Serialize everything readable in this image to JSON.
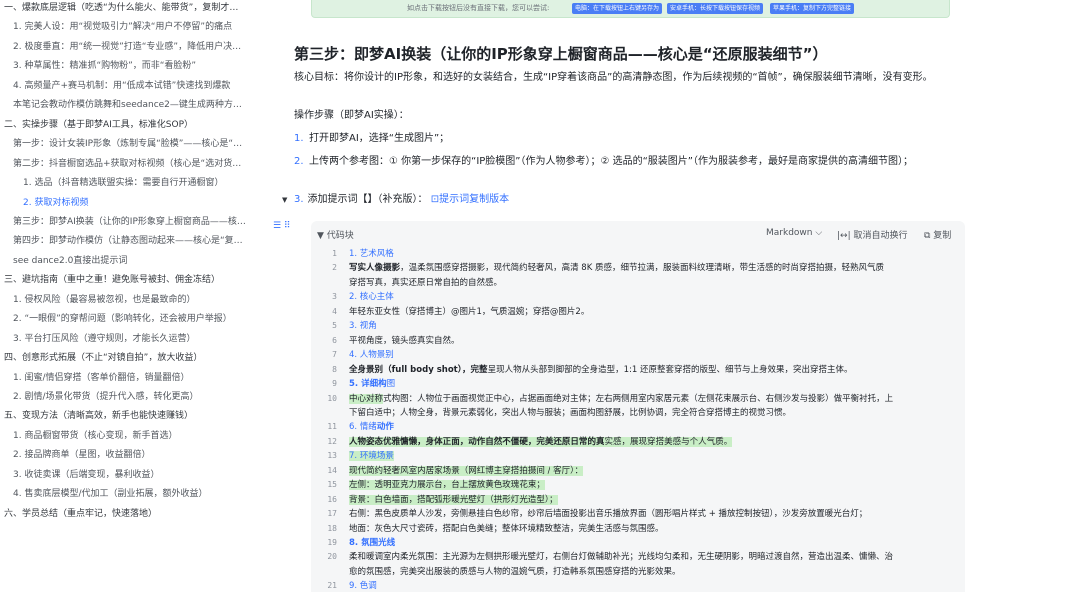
{
  "sidebar": {
    "items": [
      {
        "label": "一、爆款底层逻辑（吃透“为什么能火、能带货”，复制才…",
        "level": 1
      },
      {
        "label": "1. 完美人设：用“视觉吸引力”解决“用户不停留”的痛点",
        "level": 2
      },
      {
        "label": "2. 极度垂直：用“统一视觉”打造“专业感”，降低用户决…",
        "level": 2
      },
      {
        "label": "3. 种草属性：精准抓“购物粉”，而非“看脸粉”",
        "level": 2
      },
      {
        "label": "4. 高频量产+赛马机制：用“低成本试错”快速找到爆款",
        "level": 2
      },
      {
        "label": "本笔记会教动作模仿跳舞和seedance2—键生成两种方…",
        "level": 2
      },
      {
        "label": "二、实操步骤（基于即梦AI工具，标准化SOP）",
        "level": 1
      },
      {
        "label": "第一步：设计女装IP形象（炼制专属“脸模”——核心是“…",
        "level": 2
      },
      {
        "label": "第二步：抖音橱窗选品+获取对标视频（核心是“选对货…",
        "level": 2
      },
      {
        "label": "1. 选品（抖音精选联盟实操：需要自行开通橱窗）",
        "level": 3
      },
      {
        "label": "2. 获取对标视频",
        "level": 3,
        "active": true
      },
      {
        "label": "第三步：即梦AI换装（让你的IP形象穿上橱窗商品——核…",
        "level": 2
      },
      {
        "label": "第四步：即梦动作模仿（让静态图动起来——核心是“复…",
        "level": 2
      },
      {
        "label": "see dance2.0直接出提示词",
        "level": 2
      },
      {
        "label": "三、避坑指南（重中之重！避免账号被封、佣金冻结）",
        "level": 1
      },
      {
        "label": "1. 侵权风险（最容易被忽视，也是最致命的）",
        "level": 2
      },
      {
        "label": "2. “一眼假”的穿帮问题（影响转化，还会被用户举报）",
        "level": 2
      },
      {
        "label": "3. 平台打压风险（遵守规则，才能长久运营）",
        "level": 2
      },
      {
        "label": "四、创意形式拓展（不止“对镜自拍”，放大收益）",
        "level": 1
      },
      {
        "label": "1. 闺蜜/情侣穿搭（客单价翻倍，销量翻倍）",
        "level": 2
      },
      {
        "label": "2. 剧情/场景化带货（提升代入感，转化更高）",
        "level": 2
      },
      {
        "label": "五、变现方法（清晰高效，新手也能快速赚钱）",
        "level": 1
      },
      {
        "label": "1. 商品橱窗带货（核心变现，新手首选）",
        "level": 2
      },
      {
        "label": "2. 接品牌商单（星图，收益翻倍）",
        "level": 2
      },
      {
        "label": "3. 收徒卖课（后端变现，暴利收益）",
        "level": 2
      },
      {
        "label": "4. 售卖底层模型/代加工（副业拓展，额外收益）",
        "level": 2
      },
      {
        "label": "六、学员总结（重点牢记，快速落地）",
        "level": 1
      }
    ]
  },
  "banner": {
    "text": "如点击下载按钮后没有直接下载，您可以尝试:",
    "buttons": [
      "电脑：在下载按钮上右键另存为",
      "安卓手机：长按下载按钮保存视频",
      "苹果手机：复制下方完整链接"
    ]
  },
  "doc": {
    "heading": "第三步：即梦AI换装（让你的IP形象穿上橱窗商品——核心是“还原服装细节”）",
    "goal": "核心目标：将你设计的IP形象，和选好的女装结合，生成“IP穿着该商品”的高清静态图，作为后续视频的“首帧”，确保服装细节清晰，没有变形。",
    "ops_label": "操作步骤（即梦AI实操）：",
    "steps": [
      {
        "num": "1.",
        "text": "打开即梦AI，选择“生成图片”；"
      },
      {
        "num": "2.",
        "text": "上传两个参考图：① 你第一步保存的“IP脸模图”（作为人物参考）；② 选品的“服装图片”（作为服装参考，最好是商家提供的高清细节图）；"
      }
    ],
    "step3": {
      "toggle": "▼",
      "num": "3.",
      "text": "添加提示词【】（补充版）：",
      "link_icon": "⊡",
      "link": "提示词复制版本"
    },
    "block_tool_icon": "☰ ⠿"
  },
  "code": {
    "title_icon": "▼",
    "title": "代码块",
    "language": "Markdown ⌵",
    "wrap_label": "|↔| 取消自动换行",
    "copy_label": "⧉ 复制",
    "lines": [
      {
        "n": "1",
        "t": "1. 艺术风格",
        "style": "num"
      },
      {
        "n": "2",
        "t": "写实人像摄影，温柔氛围感穿搭摄影，现代简约轻奢风，高清 8K 质感，细节拉满，服装面料纹理清晰，带生活感的时尚穿搭拍摄，轻熟风气质穿搭写真，真实还原日常自拍的自然感。",
        "bold_prefix": "写实人像摄影"
      },
      {
        "n": "",
        "t": "穿搭写真，真实还原日常自拍的自然感。"
      },
      {
        "n": "3",
        "t": "2. 核心主体",
        "style": "num"
      },
      {
        "n": "4",
        "t": "年轻东亚女性（穿搭博主）@图片1，气质温婉；穿搭@图片2。"
      },
      {
        "n": "5",
        "t": "3. 视角",
        "style": "num"
      },
      {
        "n": "6",
        "t": "平视角度，镜头感真实自然。"
      },
      {
        "n": "7",
        "t": "4. 人物景别",
        "style": "num"
      },
      {
        "n": "8",
        "t": "全身景别（full body shot），完整呈现人物从头部到脚部的全身造型，1:1 还原整套穿搭的版型、细节与上身效果，突出穿搭主体。"
      },
      {
        "n": "9",
        "t": "5. 详细构图",
        "style": "num"
      },
      {
        "n": "10",
        "t": "中心对称式构图：人物位于画面视觉正中心，占据画面绝对主体；左右两侧用室内家居元素（左侧花束展示台、右侧沙发与投影）做平衡衬托，上"
      },
      {
        "n": "",
        "t": "下留白适中；人物全身，背景元素弱化，突出人物与服装；画面构图舒展，比例协调，完全符合穿搭博主的视觉习惯。"
      },
      {
        "n": "11",
        "t": "6. 情绪动作",
        "style": "num"
      },
      {
        "n": "12",
        "t": "人物姿态优雅慵懒，身体正面，动作自然不僵硬，完美还原日常的真实感，展现穿搭美感与个人气质。"
      },
      {
        "n": "13",
        "t": "7. 环境场景",
        "style": "num"
      },
      {
        "n": "14",
        "t": "现代简约轻奢风室内居家场景（网红博主穿搭拍摄间 / 客厅）："
      },
      {
        "n": "15",
        "t": "左侧：透明亚克力展示台，台上摆放黄色玫瑰花束；"
      },
      {
        "n": "16",
        "t": "背景：白色墙面，搭配弧形暖光壁灯（拱形灯光造型）；"
      },
      {
        "n": "17",
        "t": "右侧：黑色皮质单人沙发，旁侧悬挂白色纱帘，纱帘后墙面投影出音乐播放界面（圆形唱片样式 + 播放控制按钮），沙发旁放置暖光台灯；"
      },
      {
        "n": "18",
        "t": "地面：灰色大尺寸瓷砖，搭配白色美缝；整体环境精致整洁，完美生活感与氛围感。"
      },
      {
        "n": "19",
        "t": "8. 氛围光线",
        "style": "num"
      },
      {
        "n": "20",
        "t": "柔和暖调室内柔光氛围：主光源为左侧拱形暖光壁灯，右侧台灯做辅助补光；光线均匀柔和，无生硬阴影，明暗过渡自然，营造出温柔、慵懒、治"
      },
      {
        "n": "",
        "t": "愈的氛围感，完美突出服装的质感与人物的温婉气质，打造韩系氛围感穿搭的光影效果。"
      },
      {
        "n": "21",
        "t": "9. 色调",
        "style": "num"
      }
    ]
  }
}
